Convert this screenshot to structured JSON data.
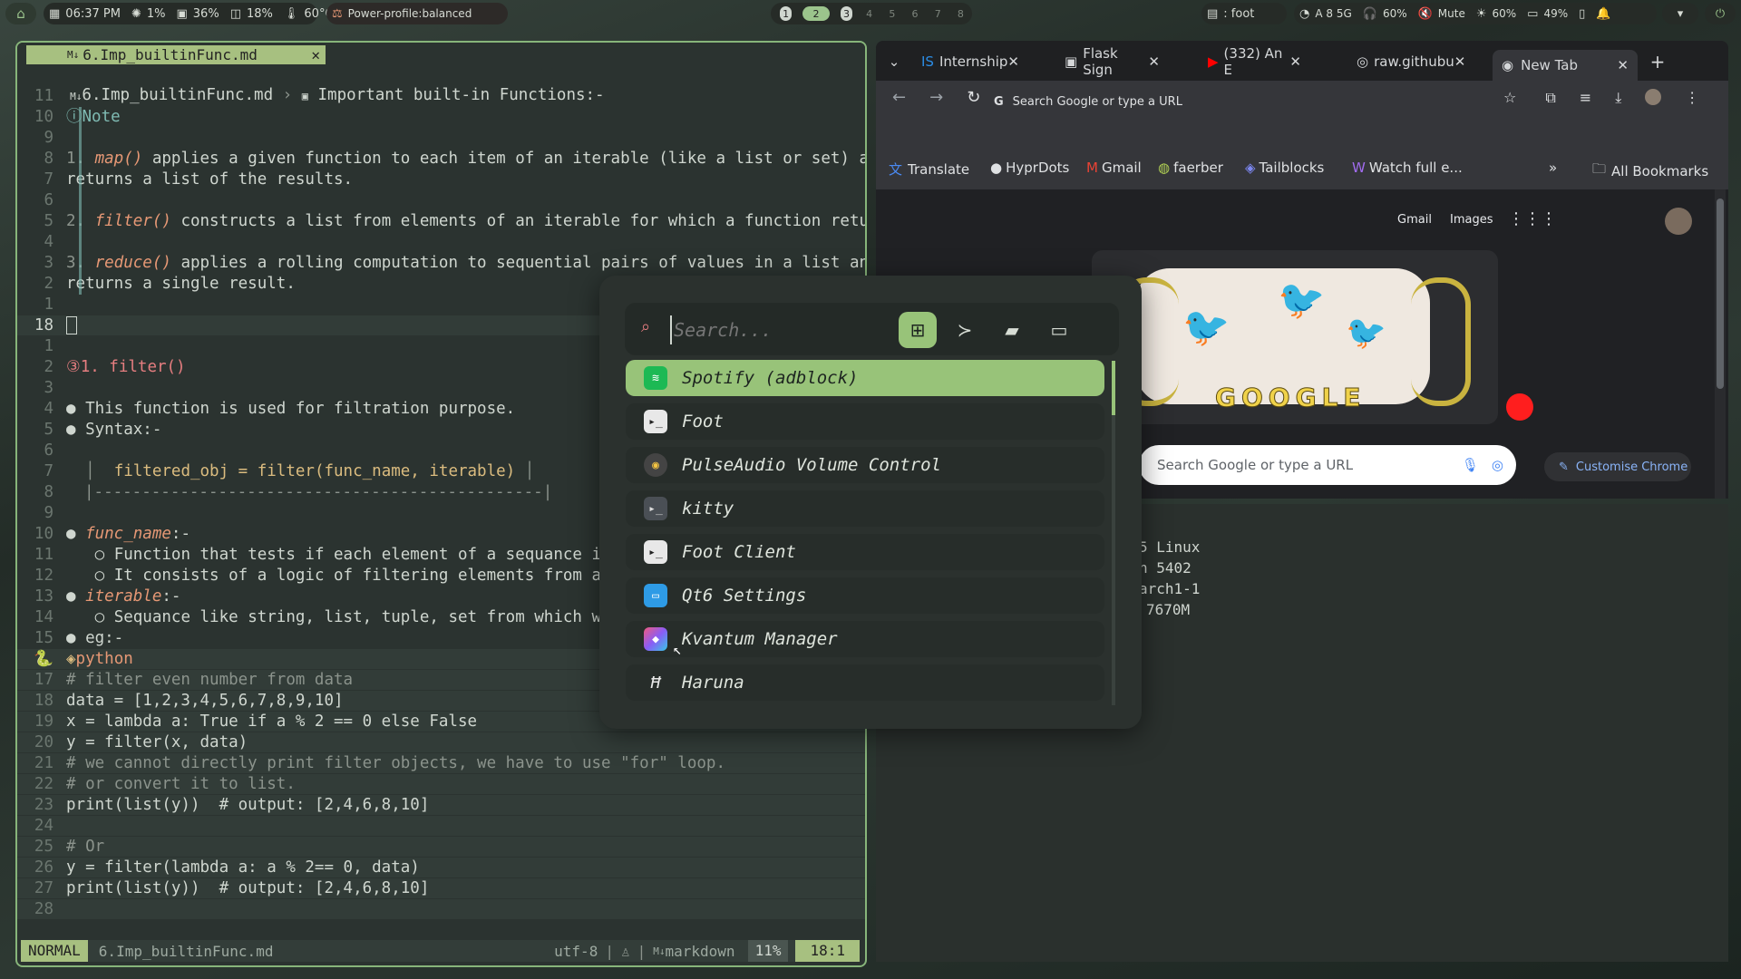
{
  "topbar": {
    "clock": "06:37 PM",
    "cpu": "1%",
    "ram": "36%",
    "disk": "18%",
    "temp": "60°C",
    "power_profile": "Power-profile:balanced",
    "workspaces": [
      "1",
      "2",
      "3",
      "4",
      "5",
      "6",
      "7",
      "8"
    ],
    "active_window": ": foot",
    "wifi": "A 8 5G",
    "headphones": "60%",
    "mute": "Mute",
    "brightness": "60%",
    "battery1": "49%"
  },
  "nvim": {
    "tab_label": "6.Imp_builtinFunc.md",
    "breadcrumb_file": "6.Imp_builtinFunc.md",
    "breadcrumb_section": "Important built-in Functions:-",
    "note_title": "Note",
    "note_lines": [
      [
        "1. ",
        "map()",
        " applies a given function to each item of an iterable (like a list or set) and"
      ],
      [
        "",
        "",
        "returns a list of the results."
      ],
      [
        "2. ",
        "filter()",
        " constructs a list from elements of an iterable for which a function return"
      ],
      [
        "3. ",
        "reduce()",
        " applies a rolling computation to sequential pairs of values in a list and"
      ],
      [
        "",
        "",
        "returns a single result."
      ]
    ],
    "heading": "1. filter()",
    "bullets": [
      "This function is used for filtration purpose.",
      "Syntax:-"
    ],
    "syntax_box": "filtered_obj = filter(func_name, iterable)",
    "syntax_rule": "|-----------------------------------------------|",
    "func_name_label": "func_name",
    "func_name_sub": [
      "Function that tests if each element of a sequance is T",
      "It consists of a logic of filtering elements from a gi"
    ],
    "iterable_label": "iterable",
    "iterable_sub": "Sequance like string, list, tuple, set from which we h",
    "eg": "eg:-",
    "code_lang": "python",
    "code_lines": [
      "# filter even number from data",
      "data = [1,2,3,4,5,6,7,8,9,10]",
      "x = lambda a: True if a % 2 == 0 else False",
      "y = filter(x, data)",
      "# we cannot directly print filter objects, we have to use \"for\" loop.",
      "# or convert it to list.",
      "print(list(y))  # output: [2,4,6,8,10]",
      "",
      "# Or",
      "y = filter(lambda a: a % 2== 0, data)",
      "print(list(y))  # output: [2,4,6,8,10]"
    ],
    "status_mode": "NORMAL",
    "status_file": "6.Imp_builtinFunc.md",
    "status_encoding": "utf-8",
    "status_filetype": "markdown",
    "status_percent": "11%",
    "status_pos": "18:1"
  },
  "browser": {
    "tabs": [
      "Internship",
      "Flask Sign",
      "(332) An E",
      "raw.githubu",
      "New Tab"
    ],
    "url_placeholder": "Search Google or type a URL",
    "bookmarks": [
      "Translate",
      "HyprDots",
      "Gmail",
      "faerber",
      "Tailblocks",
      "Watch full e..."
    ],
    "all_bookmarks": "All Bookmarks",
    "links": [
      "Gmail",
      "Images"
    ],
    "search_placeholder": "Search Google or type a URL",
    "customise": "Customise Chrome",
    "doodle_text": "GOOGLE"
  },
  "terminal": {
    "lines": [
      "5 Linux",
      "n 5402",
      "arch1-1",
      "",
      "",
      "7670M"
    ]
  },
  "launcher": {
    "search_placeholder": "Search...",
    "apps": [
      "Spotify (adblock)",
      "Foot",
      "PulseAudio Volume Control",
      "kitty",
      "Foot Client",
      "Qt6 Settings",
      "Kvantum Manager",
      "Haruna"
    ]
  }
}
